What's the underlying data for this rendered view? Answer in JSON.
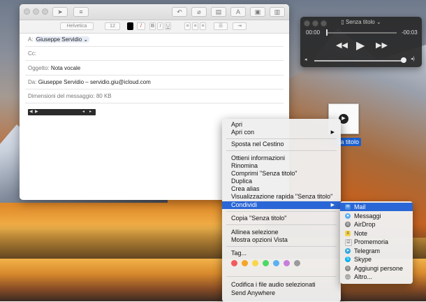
{
  "mail": {
    "format_font": "Helvetica",
    "format_size": "12",
    "to_label": "A:",
    "to_value": "Giuseppe Servidio",
    "cc_label": "Cc:",
    "subject_label": "Oggetto:",
    "subject_value": "Nota vocale",
    "from_label": "Da:",
    "from_value": "Giuseppe Servidio – servidio.giu@icloud.com",
    "size_label": "Dimensioni del messaggio:",
    "size_value": "80 KB"
  },
  "quicktime": {
    "title": "Senza titolo",
    "time_elapsed": "00:00",
    "time_remaining": "-00:03"
  },
  "desktop_file": {
    "label": "za titolo"
  },
  "context_menu": {
    "items": [
      "Apri",
      "Apri con",
      "Sposta nel Cestino",
      "Ottieni informazioni",
      "Rinomina",
      "Comprimi \"Senza titolo\"",
      "Duplica",
      "Crea alias",
      "Visualizzazione rapida \"Senza titolo\"",
      "Condividi",
      "Copia \"Senza titolo\"",
      "Allinea selezione",
      "Mostra opzioni Vista",
      "Tag...",
      "Codifica i file audio selezionati",
      "Send Anywhere"
    ],
    "tag_colors": [
      "#f25b5b",
      "#f5a623",
      "#f8d648",
      "#4cd964",
      "#5ab0f5",
      "#c77ddb",
      "#9b9b9b"
    ]
  },
  "share_submenu": {
    "items": [
      "Mail",
      "Messaggi",
      "AirDrop",
      "Note",
      "Promemoria",
      "Telegram",
      "Skype",
      "Aggiungi persone",
      "Altro..."
    ]
  },
  "colors": {
    "selection": "#2a66d6"
  }
}
